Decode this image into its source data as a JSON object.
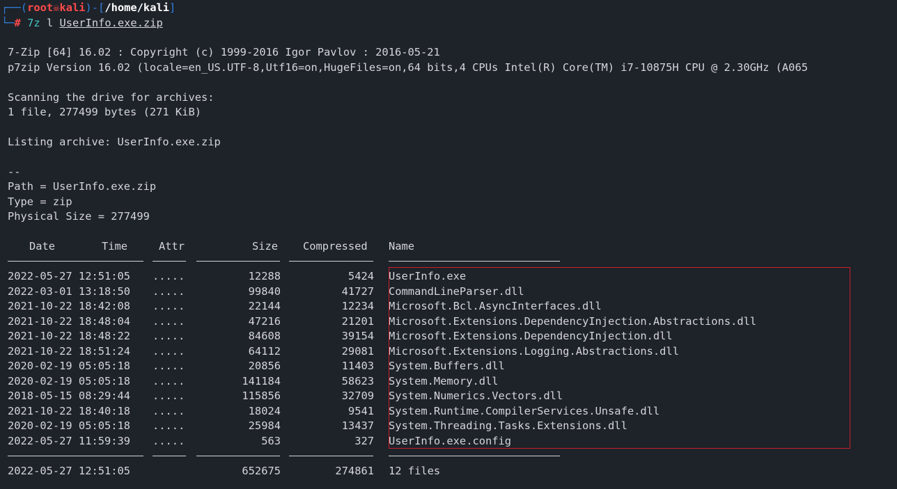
{
  "prompt": {
    "user": "root",
    "skull_glyph": "☠",
    "host": "kali",
    "cwd": "/home/kali",
    "hash": "#",
    "command": "7z",
    "flag": "l",
    "file_arg": "UserInfo.exe.zip"
  },
  "output": {
    "line1": "7-Zip [64] 16.02 : Copyright (c) 1999-2016 Igor Pavlov : 2016-05-21",
    "line2": "p7zip Version 16.02 (locale=en_US.UTF-8,Utf16=on,HugeFiles=on,64 bits,4 CPUs Intel(R) Core(TM) i7-10875H CPU @ 2.30GHz (A065",
    "scan1": "Scanning the drive for archives:",
    "scan2": "1 file, 277499 bytes (271 KiB)",
    "listing": "Listing archive: UserInfo.exe.zip",
    "sep": "--",
    "path": "Path = UserInfo.exe.zip",
    "type": "Type = zip",
    "physsize": "Physical Size = 277499"
  },
  "table": {
    "headers": {
      "date": "Date",
      "time": "Time",
      "attr": "Attr",
      "size": "Size",
      "compressed": "Compressed",
      "name": "Name"
    },
    "rows": [
      {
        "datetime": "2022-05-27 12:51:05",
        "attr": ".....",
        "size": "12288",
        "compressed": "5424",
        "name": "UserInfo.exe"
      },
      {
        "datetime": "2022-03-01 13:18:50",
        "attr": ".....",
        "size": "99840",
        "compressed": "41727",
        "name": "CommandLineParser.dll"
      },
      {
        "datetime": "2021-10-22 18:42:08",
        "attr": ".....",
        "size": "22144",
        "compressed": "12234",
        "name": "Microsoft.Bcl.AsyncInterfaces.dll"
      },
      {
        "datetime": "2021-10-22 18:48:04",
        "attr": ".....",
        "size": "47216",
        "compressed": "21201",
        "name": "Microsoft.Extensions.DependencyInjection.Abstractions.dll"
      },
      {
        "datetime": "2021-10-22 18:48:22",
        "attr": ".....",
        "size": "84608",
        "compressed": "39154",
        "name": "Microsoft.Extensions.DependencyInjection.dll"
      },
      {
        "datetime": "2021-10-22 18:51:24",
        "attr": ".....",
        "size": "64112",
        "compressed": "29081",
        "name": "Microsoft.Extensions.Logging.Abstractions.dll"
      },
      {
        "datetime": "2020-02-19 05:05:18",
        "attr": ".....",
        "size": "20856",
        "compressed": "11403",
        "name": "System.Buffers.dll"
      },
      {
        "datetime": "2020-02-19 05:05:18",
        "attr": ".....",
        "size": "141184",
        "compressed": "58623",
        "name": "System.Memory.dll"
      },
      {
        "datetime": "2018-05-15 08:29:44",
        "attr": ".....",
        "size": "115856",
        "compressed": "32709",
        "name": "System.Numerics.Vectors.dll"
      },
      {
        "datetime": "2021-10-22 18:40:18",
        "attr": ".....",
        "size": "18024",
        "compressed": "9541",
        "name": "System.Runtime.CompilerServices.Unsafe.dll"
      },
      {
        "datetime": "2020-02-19 05:05:18",
        "attr": ".....",
        "size": "25984",
        "compressed": "13437",
        "name": "System.Threading.Tasks.Extensions.dll"
      },
      {
        "datetime": "2022-05-27 11:59:39",
        "attr": ".....",
        "size": "563",
        "compressed": "327",
        "name": "UserInfo.exe.config"
      }
    ],
    "footer": {
      "datetime": "2022-05-27 12:51:05",
      "size": "652675",
      "compressed": "274861",
      "name": "12 files"
    }
  },
  "colors": {
    "background": "#1e2229",
    "prompt_frame": "#2f7fd8",
    "root_user": "#ff4a4a",
    "command": "#43c7c2",
    "highlight_box": "#c8202b"
  }
}
